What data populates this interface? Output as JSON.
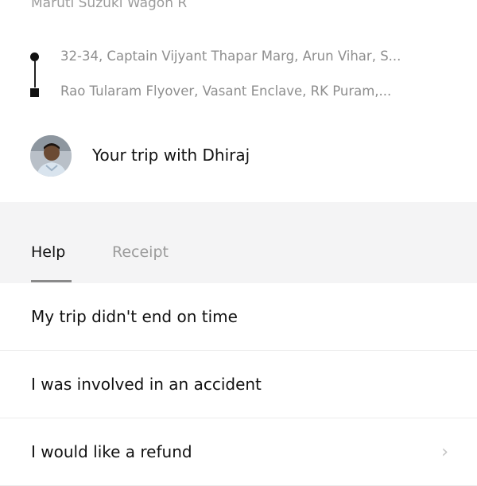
{
  "vehicle": "Maruti Suzuki Wagon R",
  "route": {
    "pickup": "32-34, Captain Vijyant Thapar Marg, Arun Vihar, S...",
    "dropoff": "Rao Tularam Flyover, Vasant Enclave, RK Puram,..."
  },
  "driver": {
    "trip_title": "Your trip with Dhiraj"
  },
  "tabs": [
    {
      "label": "Help",
      "active": true
    },
    {
      "label": "Receipt",
      "active": false
    }
  ],
  "help_items": [
    {
      "label": "My trip didn't end on time"
    },
    {
      "label": "I was involved in an accident"
    },
    {
      "label": "I would like a refund"
    }
  ],
  "icons": {
    "pickup": "pickup-dot-icon",
    "dropoff": "dropoff-square-icon",
    "chevron": "chevron-right-icon"
  },
  "colors": {
    "muted_text": "#9b9b9b",
    "tabs_background": "#f4f4f5",
    "active_tab_underline": "#8a8a8a"
  }
}
